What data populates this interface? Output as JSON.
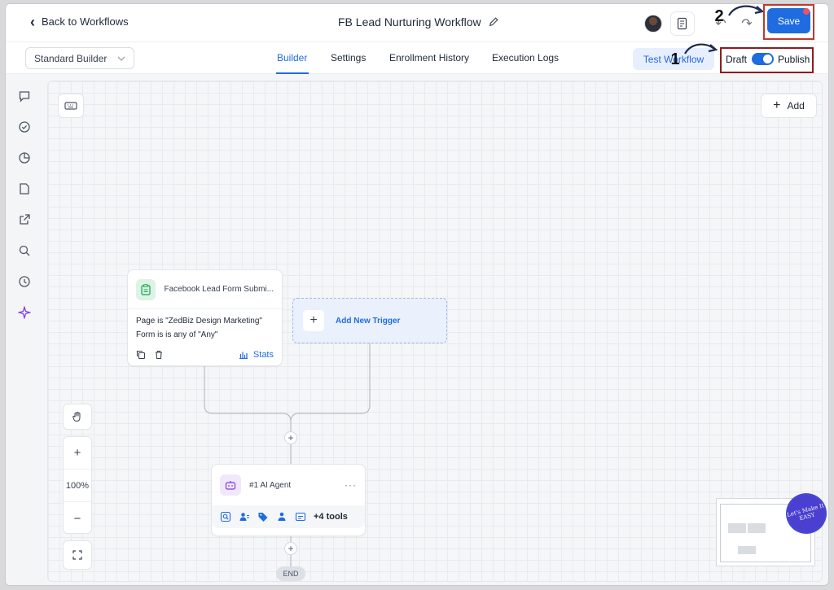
{
  "header": {
    "back_label": "Back to Workflows",
    "title": "FB Lead Nurturing Workflow",
    "save_label": "Save",
    "step_one": "1",
    "step_two": "2"
  },
  "subheader": {
    "builder_select": "Standard Builder",
    "tabs": [
      "Builder",
      "Settings",
      "Enrollment History",
      "Execution Logs"
    ],
    "test_label": "Test Workflow",
    "draft_label": "Draft",
    "publish_label": "Publish",
    "published": true
  },
  "canvas": {
    "add_label": "Add",
    "trigger": {
      "title": "Facebook Lead Form Submi...",
      "line1": "Page is \"ZedBiz Design Marketing\"",
      "line2": "Form is is any of \"Any\"",
      "stats_label": "Stats"
    },
    "add_trigger_label": "Add New Trigger",
    "agent": {
      "title": "#1 AI Agent",
      "more": "···",
      "tools_label": "+4 tools"
    },
    "end_label": "END",
    "zoom": {
      "in": "+",
      "level": "100%",
      "out": "−"
    },
    "logo_text": "Let's Make It EASY"
  },
  "colors": {
    "accent": "#1f6ce0",
    "highlight": "#c0392b"
  }
}
